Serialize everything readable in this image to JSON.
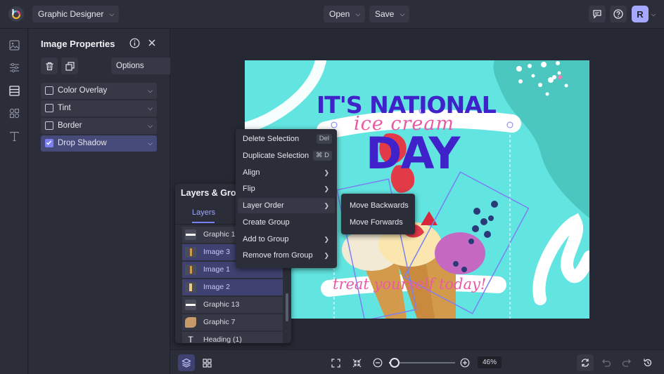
{
  "header": {
    "project_name": "Graphic Designer",
    "open_label": "Open",
    "save_label": "Save",
    "avatar_initial": "R"
  },
  "panel": {
    "title": "Image Properties",
    "options_label": "Options",
    "properties": [
      {
        "label": "Color Overlay",
        "checked": false
      },
      {
        "label": "Tint",
        "checked": false
      },
      {
        "label": "Border",
        "checked": false
      },
      {
        "label": "Drop Shadow",
        "checked": true
      }
    ]
  },
  "layers": {
    "title": "Layers & Groups",
    "tab_label": "Layers",
    "items": [
      {
        "label": "Graphic 16",
        "selected": false
      },
      {
        "label": "Image 3",
        "selected": true
      },
      {
        "label": "Image 1",
        "selected": true
      },
      {
        "label": "Image 2",
        "selected": true
      },
      {
        "label": "Graphic 13",
        "selected": false
      },
      {
        "label": "Graphic 7",
        "selected": false
      },
      {
        "label": "Heading (1)",
        "selected": false
      }
    ]
  },
  "context_menu": {
    "items": [
      {
        "label": "Delete Selection",
        "shortcut": "Del"
      },
      {
        "label": "Duplicate Selection",
        "shortcut": "⌘ D"
      },
      {
        "label": "Align",
        "submenu": true
      },
      {
        "label": "Flip",
        "submenu": true
      },
      {
        "label": "Layer Order",
        "submenu": true,
        "hover": true
      },
      {
        "label": "Create Group"
      },
      {
        "label": "Add to Group",
        "submenu": true
      },
      {
        "label": "Remove from Group",
        "submenu": true
      }
    ],
    "submenu_items": [
      "Move Backwards",
      "Move Forwards"
    ]
  },
  "artboard": {
    "headline_1": "IT'S NATIONAL",
    "script_text": "ice cream",
    "headline_2": "DAY",
    "tagline": "treat yourself today!",
    "colors": {
      "background": "#62e4e0",
      "headline": "#3f22c9",
      "script": "#e85aa6",
      "accent": "#4cc7c0"
    }
  },
  "toolbar": {
    "zoom_label": "46%",
    "zoom_fraction": 0.08
  },
  "colors": {
    "accent": "#7b80f5",
    "panel": "#2b2d38",
    "background": "#262833"
  }
}
